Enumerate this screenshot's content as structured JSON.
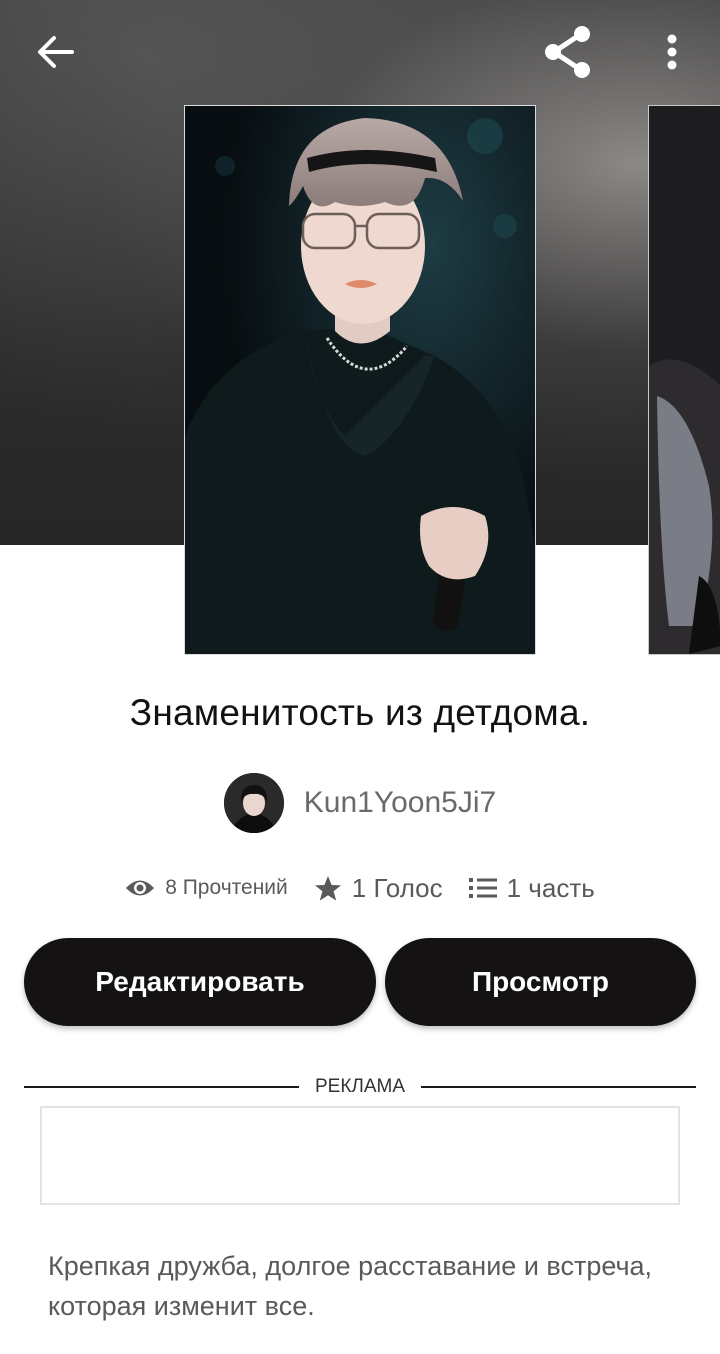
{
  "header": {
    "back_icon": "arrow-left-icon",
    "share_icon": "share-icon",
    "more_icon": "more-vertical-icon"
  },
  "story": {
    "title": "Знаменитость из детдома.",
    "author": "Kun1Yoon5Ji7",
    "stats": {
      "reads": "8 Прочтений",
      "votes": "1 Голос",
      "parts": "1 часть"
    },
    "description": "Крепкая дружба, долгое расставание и встреча, которая изменит все."
  },
  "actions": {
    "edit_label": "Редактировать",
    "view_label": "Просмотр"
  },
  "ad": {
    "label": "РЕКЛАМА"
  },
  "colors": {
    "button_bg": "#141213",
    "text_primary": "#121212",
    "text_secondary": "#5a5a5a"
  }
}
